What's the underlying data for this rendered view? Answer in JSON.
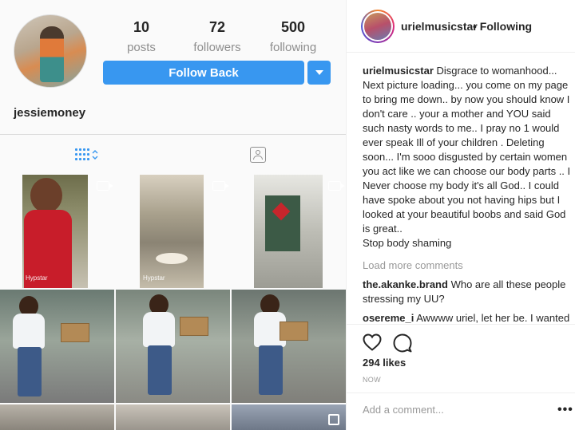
{
  "profile": {
    "username": "jessiemoney",
    "stats": [
      {
        "count": "10",
        "label": "posts"
      },
      {
        "count": "72",
        "label": "followers"
      },
      {
        "count": "500",
        "label": "following"
      }
    ],
    "follow_button_label": "Follow Back"
  },
  "grid": {
    "watermark": "Hypstar"
  },
  "post": {
    "author": "urielmusicstar",
    "follow_status": "• Following",
    "caption": "Disgrace to womanhood... Next picture loading... you come on my page to bring me down.. by now you should know I don't care .. your a mother and YOU said such nasty words to me.. I pray no 1 would ever speak Ill of your children . Deleting soon... I'm sooo disgusted by certain women you act like we can choose our body parts .. I Never choose my body it's all God.. I could have spoke about you not having hips but I looked at your beautiful boobs and said God is great..",
    "caption_last": "Stop body shaming",
    "load_more": "Load more comments",
    "comments": [
      {
        "user": "the.akanke.brand",
        "text": "Who are all these people stressing my UU?"
      },
      {
        "user": "osereme_i",
        "text": "Awwww uriel, let her be. I wanted to yab her but going through her"
      }
    ],
    "likes": "294 likes",
    "time": "NOW",
    "add_comment_placeholder": "Add a comment...",
    "more": "•••"
  },
  "icons": {
    "grid_tab": "grid-icon",
    "tagged_tab": "tagged-icon",
    "like": "heart-icon",
    "comment": "comment-icon",
    "dropdown": "chevron-down-icon"
  },
  "colors": {
    "accent": "#3897f0",
    "muted": "#8e8e8e"
  }
}
